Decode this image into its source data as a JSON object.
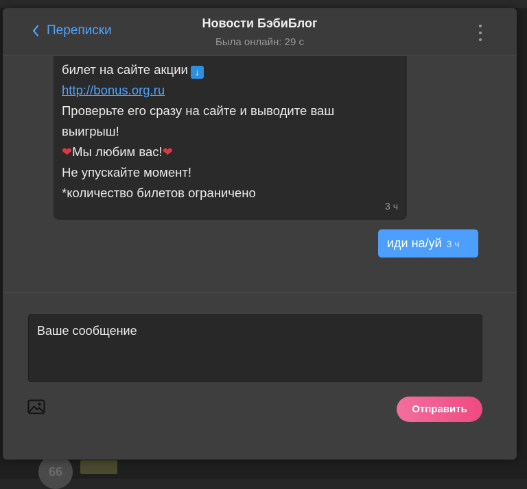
{
  "header": {
    "back_label": "Переписки",
    "title": "Новости БэбиБлог",
    "status": "Была онлайн: 29 с"
  },
  "messages": {
    "incoming": {
      "line1": "билет на сайте акции",
      "link": "http://bonus.org.ru",
      "line3": "Проверьте его сразу на сайте и выводите ваш",
      "line4": "выигрыш!",
      "line5": "Мы любим вас!",
      "line6": "Не упускайте момент!",
      "line7": "*количество билетов ограничено",
      "time": "3 ч"
    },
    "outgoing": {
      "text": "иди на/уй",
      "time": "3 ч"
    }
  },
  "composer": {
    "placeholder": "Ваше сообщение",
    "send_label": "Отправить"
  },
  "background": {
    "avatar_text": "66"
  },
  "colors": {
    "accent": "#4c9ffe",
    "send_gradient_start": "#f36e9e",
    "send_gradient_end": "#ef4a80",
    "heart": "#e0364b"
  },
  "icons": {
    "back": "chevron-left-icon",
    "more": "more-vertical-icon",
    "image": "image-icon",
    "arrow": "arrow-down-emoji",
    "heart": "heart-emoji"
  }
}
